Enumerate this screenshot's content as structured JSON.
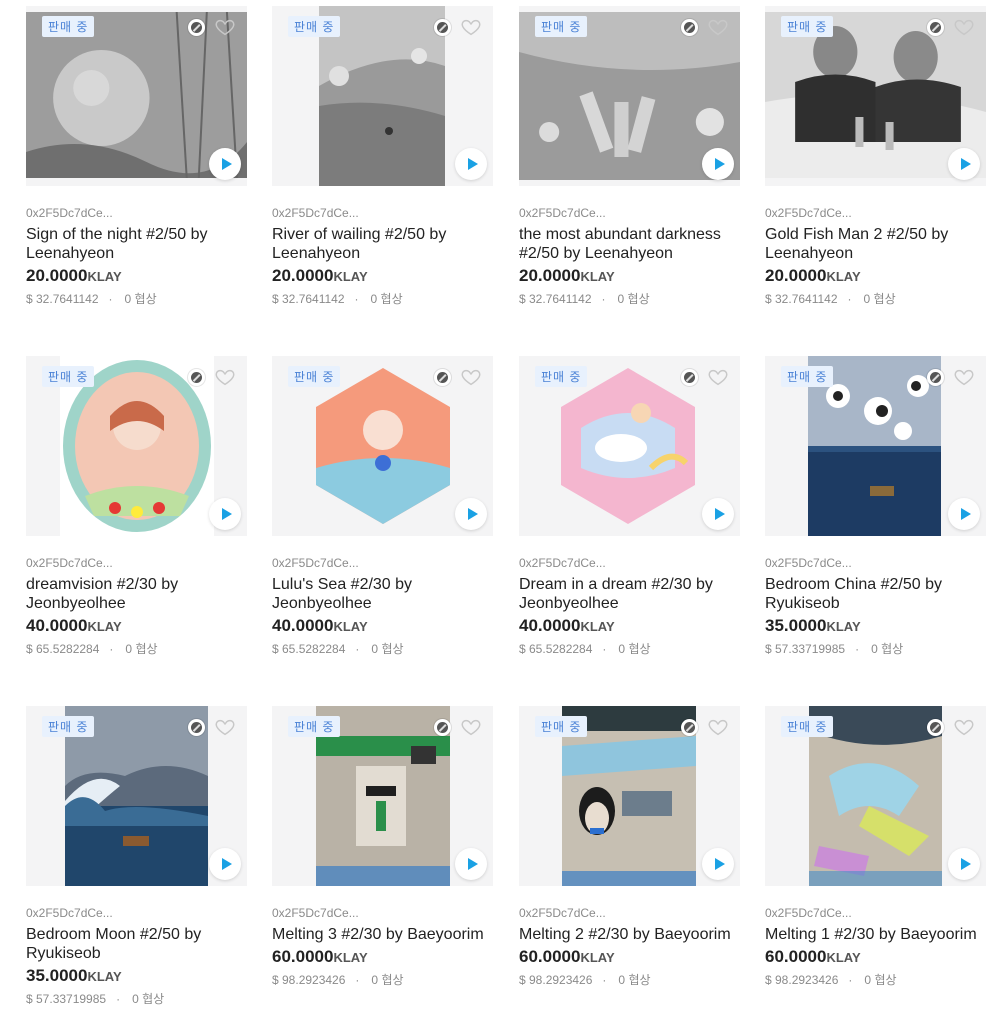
{
  "badge_label": "판매 중",
  "currency": "KLAY",
  "offers_suffix": "협상",
  "cards": [
    {
      "owner": "0x2F5Dc7dCe...",
      "title": "Sign of the night #2/50 by Leenahyeon",
      "price": "20.0000",
      "usd": "$ 32.7641142",
      "offers": "0"
    },
    {
      "owner": "0x2F5Dc7dCe...",
      "title": "River of wailing #2/50 by Leenahyeon",
      "price": "20.0000",
      "usd": "$ 32.7641142",
      "offers": "0"
    },
    {
      "owner": "0x2F5Dc7dCe...",
      "title": "the most abundant darkness #2/50 by Leenahyeon",
      "price": "20.0000",
      "usd": "$ 32.7641142",
      "offers": "0"
    },
    {
      "owner": "0x2F5Dc7dCe...",
      "title": "Gold Fish Man 2 #2/50 by Leenahyeon",
      "price": "20.0000",
      "usd": "$ 32.7641142",
      "offers": "0"
    },
    {
      "owner": "0x2F5Dc7dCe...",
      "title": "dreamvision #2/30 by Jeonbyeolhee",
      "price": "40.0000",
      "usd": "$ 65.5282284",
      "offers": "0"
    },
    {
      "owner": "0x2F5Dc7dCe...",
      "title": "Lulu's Sea #2/30 by Jeonbyeolhee",
      "price": "40.0000",
      "usd": "$ 65.5282284",
      "offers": "0"
    },
    {
      "owner": "0x2F5Dc7dCe...",
      "title": "Dream in a dream #2/30 by Jeonbyeolhee",
      "price": "40.0000",
      "usd": "$ 65.5282284",
      "offers": "0"
    },
    {
      "owner": "0x2F5Dc7dCe...",
      "title": "Bedroom China #2/50 by Ryukiseob",
      "price": "35.0000",
      "usd": "$ 57.33719985",
      "offers": "0"
    },
    {
      "owner": "0x2F5Dc7dCe...",
      "title": "Bedroom Moon #2/50 by Ryukiseob",
      "price": "35.0000",
      "usd": "$ 57.33719985",
      "offers": "0"
    },
    {
      "owner": "0x2F5Dc7dCe...",
      "title": "Melting 3 #2/30 by Baeyoorim",
      "price": "60.0000",
      "usd": "$ 98.2923426",
      "offers": "0"
    },
    {
      "owner": "0x2F5Dc7dCe...",
      "title": "Melting 2 #2/30 by Baeyoorim",
      "price": "60.0000",
      "usd": "$ 98.2923426",
      "offers": "0"
    },
    {
      "owner": "0x2F5Dc7dCe...",
      "title": "Melting 1 #2/30 by Baeyoorim",
      "price": "60.0000",
      "usd": "$ 98.2923426",
      "offers": "0"
    }
  ]
}
